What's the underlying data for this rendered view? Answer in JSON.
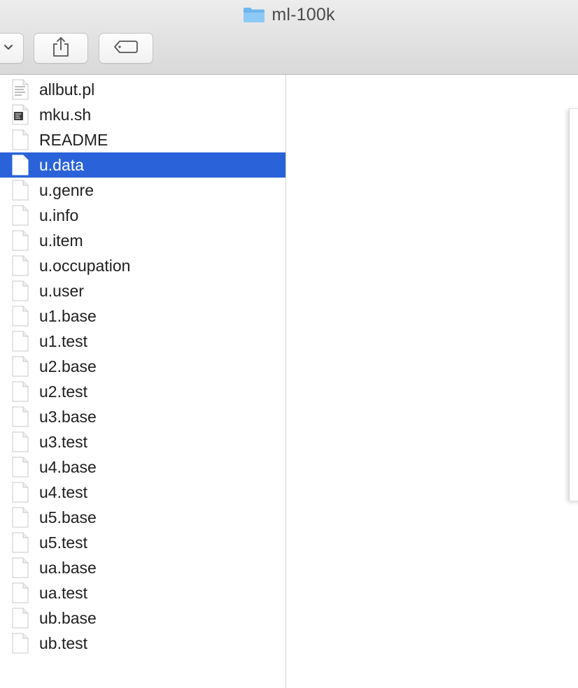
{
  "window": {
    "title": "ml-100k",
    "title_icon": "folder-icon"
  },
  "toolbar": {
    "buttons": [
      {
        "name": "view-options-dropdown",
        "icon": "chevron-down-icon"
      },
      {
        "name": "share-button",
        "icon": "share-icon"
      },
      {
        "name": "tags-button",
        "icon": "tag-icon"
      }
    ]
  },
  "files": [
    {
      "name": "allbut.pl",
      "icon": "script-file-icon",
      "selected": false
    },
    {
      "name": "mku.sh",
      "icon": "shell-script-icon",
      "selected": false
    },
    {
      "name": "README",
      "icon": "document-icon",
      "selected": false
    },
    {
      "name": "u.data",
      "icon": "document-icon",
      "selected": true
    },
    {
      "name": "u.genre",
      "icon": "document-icon",
      "selected": false
    },
    {
      "name": "u.info",
      "icon": "document-icon",
      "selected": false
    },
    {
      "name": "u.item",
      "icon": "document-icon",
      "selected": false
    },
    {
      "name": "u.occupation",
      "icon": "document-icon",
      "selected": false
    },
    {
      "name": "u.user",
      "icon": "document-icon",
      "selected": false
    },
    {
      "name": "u1.base",
      "icon": "document-icon",
      "selected": false
    },
    {
      "name": "u1.test",
      "icon": "document-icon",
      "selected": false
    },
    {
      "name": "u2.base",
      "icon": "document-icon",
      "selected": false
    },
    {
      "name": "u2.test",
      "icon": "document-icon",
      "selected": false
    },
    {
      "name": "u3.base",
      "icon": "document-icon",
      "selected": false
    },
    {
      "name": "u3.test",
      "icon": "document-icon",
      "selected": false
    },
    {
      "name": "u4.base",
      "icon": "document-icon",
      "selected": false
    },
    {
      "name": "u4.test",
      "icon": "document-icon",
      "selected": false
    },
    {
      "name": "u5.base",
      "icon": "document-icon",
      "selected": false
    },
    {
      "name": "u5.test",
      "icon": "document-icon",
      "selected": false
    },
    {
      "name": "ua.base",
      "icon": "document-icon",
      "selected": false
    },
    {
      "name": "ua.test",
      "icon": "document-icon",
      "selected": false
    },
    {
      "name": "ub.base",
      "icon": "document-icon",
      "selected": false
    },
    {
      "name": "ub.test",
      "icon": "document-icon",
      "selected": false
    }
  ],
  "colors": {
    "selection": "#2a63d9",
    "folder": "#6fb8ee",
    "text": "#1f1f1f"
  }
}
